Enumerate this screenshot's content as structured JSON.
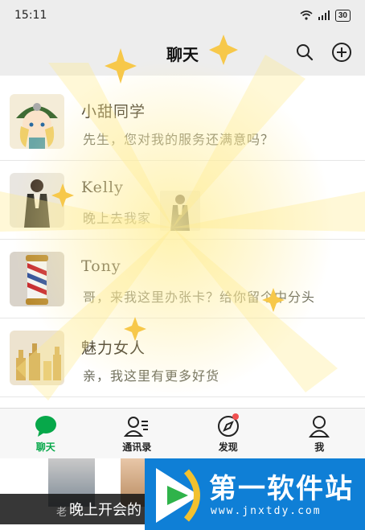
{
  "status": {
    "time": "15:11",
    "battery": "30"
  },
  "nav": {
    "title": "聊天"
  },
  "chats": [
    {
      "name": "小甜同学",
      "preview": "先生，您对我的服务还满意吗？"
    },
    {
      "name": "Kelly",
      "preview": "晚上去我家"
    },
    {
      "name": "Tony",
      "preview": "哥，来我这里办张卡？给你留个中分头"
    },
    {
      "name": "魅力女人",
      "preview": "亲，我这里有更多好货"
    }
  ],
  "tabs": [
    {
      "label": "聊天",
      "icon": "chat-bubble-icon",
      "active": true
    },
    {
      "label": "通讯录",
      "icon": "contacts-icon"
    },
    {
      "label": "发现",
      "icon": "compass-icon",
      "badge": true
    },
    {
      "label": "我",
      "icon": "person-icon"
    }
  ],
  "overlay": {
    "caption": "晚上开会的",
    "caption_prefix": "老",
    "brand_name": "第一软件站",
    "brand_url": "www.jnxtdy.com"
  },
  "colors": {
    "accent": "#07a84a",
    "badge": "#f05050",
    "brand": "#0f7fd6"
  }
}
